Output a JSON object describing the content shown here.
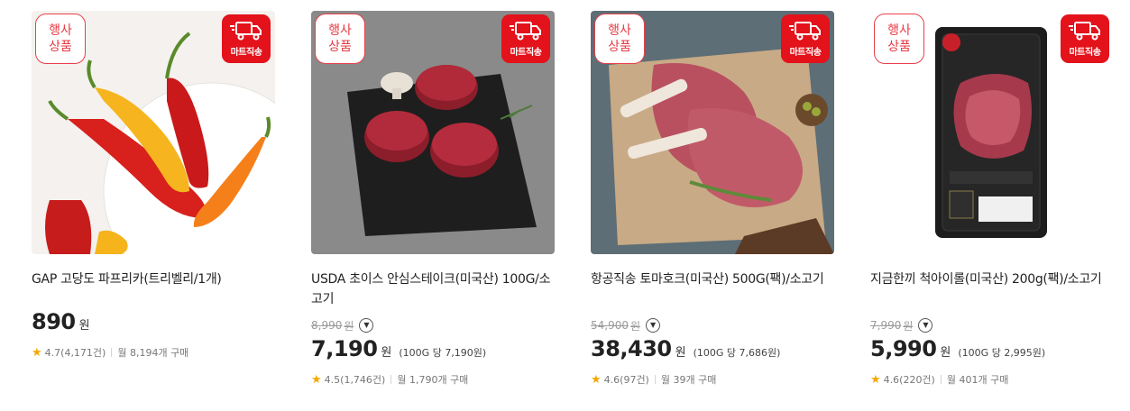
{
  "badges": {
    "event_line1": "행사",
    "event_line2": "상품",
    "mart": "마트직송"
  },
  "colors": {
    "accent_red": "#e3121b",
    "star": "#f5a800"
  },
  "products": [
    {
      "title": "GAP 고당도 파프리카(트리벨리/1개)",
      "original_price": "",
      "price": "890",
      "currency": "원",
      "unit_price": "",
      "rating": "4.7(4,171건)",
      "monthly": "월 8,194개 구매",
      "image": "colorful-peppers"
    },
    {
      "title": "USDA 초이스 안심스테이크(미국산) 100G/소고기",
      "original_price": "8,990",
      "price": "7,190",
      "currency": "원",
      "unit_price": "(100G 당 7,190원)",
      "rating": "4.5(1,746건)",
      "monthly": "월 1,790개 구매",
      "image": "tenderloin-steaks"
    },
    {
      "title": "항공직송 토마호크(미국산) 500G(팩)/소고기",
      "original_price": "54,900",
      "price": "38,430",
      "currency": "원",
      "unit_price": "(100G 당 7,686원)",
      "rating": "4.6(97건)",
      "monthly": "월 39개 구매",
      "image": "tomahawk-steaks"
    },
    {
      "title": "지금한끼 척아이롤(미국산) 200g(팩)/소고기",
      "original_price": "7,990",
      "price": "5,990",
      "currency": "원",
      "unit_price": "(100G 당 2,995원)",
      "rating": "4.6(220건)",
      "monthly": "월 401개 구매",
      "image": "packaged-chuck-eye-roll"
    }
  ]
}
